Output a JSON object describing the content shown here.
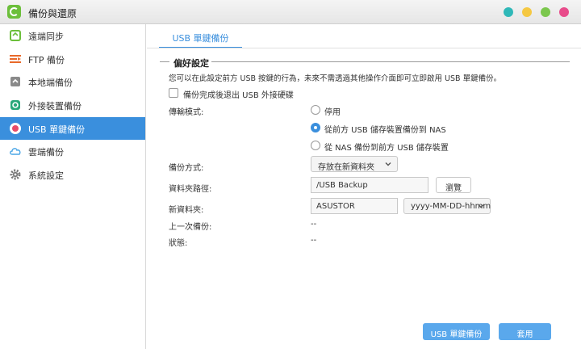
{
  "window": {
    "title": "備份與還原",
    "controls": [
      {
        "name": "window-btn-teal",
        "color": "#2fb8b8"
      },
      {
        "name": "window-btn-yellow",
        "color": "#f5c842"
      },
      {
        "name": "window-btn-green",
        "color": "#7bc74d"
      },
      {
        "name": "window-btn-pink",
        "color": "#e84c8b"
      }
    ]
  },
  "sidebar": {
    "items": [
      {
        "label": "遠端同步",
        "icon": "sync-icon"
      },
      {
        "label": "FTP 備份",
        "icon": "ftp-icon"
      },
      {
        "label": "本地端備份",
        "icon": "local-backup-icon"
      },
      {
        "label": "外接裝置備份",
        "icon": "external-device-icon"
      },
      {
        "label": "USB 單鍵備份",
        "icon": "usb-icon",
        "active": true
      },
      {
        "label": "雲端備份",
        "icon": "cloud-icon"
      },
      {
        "label": "系統設定",
        "icon": "gear-icon"
      }
    ]
  },
  "tabs": [
    {
      "label": "USB 單鍵備份"
    }
  ],
  "section": {
    "title": "偏好設定",
    "description": "您可以在此設定前方 USB 按鍵的行為，未來不需透過其他操作介面即可立即啟用 USB 單鍵備份。",
    "eject_checkbox": {
      "label": "備份完成後退出 USB 外接硬碟",
      "checked": false
    }
  },
  "form": {
    "transfer_mode": {
      "label": "傳輸模式:",
      "options": [
        {
          "label": "停用",
          "selected": false
        },
        {
          "label": "從前方 USB 儲存裝置備份到 NAS",
          "selected": true
        },
        {
          "label": "從 NAS 備份到前方 USB 儲存裝置",
          "selected": false
        }
      ]
    },
    "backup_method": {
      "label": "備份方式:",
      "value": "存放在新資料夾"
    },
    "folder_path": {
      "label": "資料夾路徑:",
      "value": "/USB Backup",
      "browse_label": "瀏覽"
    },
    "new_folder": {
      "label": "新資料夾:",
      "name_value": "ASUSTOR",
      "format_value": "yyyy-MM-DD-hhmm"
    },
    "last_backup": {
      "label": "上一次備份:",
      "value": "--"
    },
    "status": {
      "label": "狀態:",
      "value": "--"
    }
  },
  "footer": {
    "usb_backup_button": "USB 單鍵備份",
    "apply_button": "套用"
  },
  "colors": {
    "accent": "#3a8fdd",
    "primary_button": "#5aa8ec"
  }
}
